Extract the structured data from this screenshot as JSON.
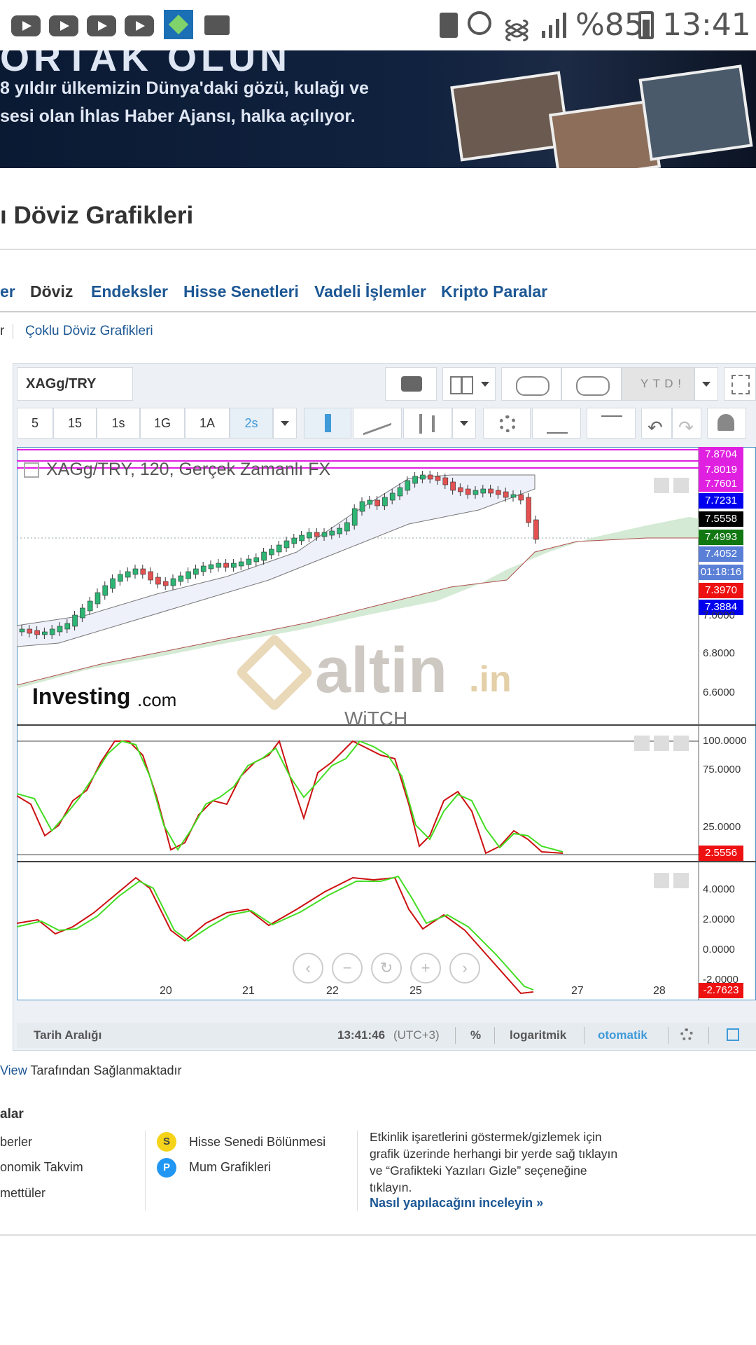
{
  "status_bar": {
    "battery": "%85",
    "time": "13:41"
  },
  "banner": {
    "line1": "8 yıldır ülkemizin Dünya'daki gözü, kulağı ve",
    "line2": "sesi olan İhlas Haber Ajansı, halka açılıyor."
  },
  "page": {
    "title": "ı Döviz Grafikleri"
  },
  "nav": {
    "items": [
      "er",
      "Döviz",
      "Endeksler",
      "Hisse Senetleri",
      "Vadeli İşlemler",
      "Kripto Paralar"
    ]
  },
  "subnav": {
    "prev": "r",
    "link": "Çoklu Döviz Grafikleri"
  },
  "toolbar": {
    "symbol": "XAGg/TRY",
    "ytd_label": "Y T D !",
    "intervals": [
      "5",
      "15",
      "1s",
      "1G",
      "1A",
      "2s"
    ],
    "active_interval": "2s"
  },
  "chart": {
    "series_title": "XAGg/TRY, 120, Gerçek Zamanlı FX",
    "price_labels": [
      {
        "text": "7.8704",
        "color": "#e020e0"
      },
      {
        "text": "7.8019",
        "color": "#e020e0"
      },
      {
        "text": "7.7601",
        "color": "#e020e0"
      },
      {
        "text": "7.7231",
        "color": "#0000ee"
      },
      {
        "text": "7.5558",
        "color": "#000000"
      },
      {
        "text": "7.4993",
        "color": "#117711"
      },
      {
        "text": "7.4052",
        "color": "#5a7fd6"
      },
      {
        "text": "01:18:16",
        "color": "#5a7fd6"
      },
      {
        "text": "7.3970",
        "color": "#ee1111"
      },
      {
        "text": "7.3884",
        "color": "#0000ee"
      }
    ],
    "main_axis": [
      "7.0000",
      "6.8000",
      "6.6000"
    ],
    "stoch_axis": [
      "100.0000",
      "75.0000",
      "25.0000"
    ],
    "stoch_value": "2.5556",
    "macd_axis": [
      "4.0000",
      "2.0000",
      "0.0000",
      "-2.0000"
    ],
    "macd_value": "-2.7623",
    "x_labels": [
      "20",
      "21",
      "22",
      "25",
      "27",
      "28"
    ],
    "watermark_brand": "altin",
    "watermark_tld": ".in",
    "watermark_sub": "WiTCH",
    "investing_logo": "Investing",
    "investing_suffix": ".com"
  },
  "chart_data": {
    "type": "line",
    "title": "XAGg/TRY, 120, Gerçek Zamanlı FX",
    "x": [
      "20",
      "21",
      "22",
      "25",
      "27",
      "28"
    ],
    "ylim": [
      6.6,
      7.87
    ],
    "series": []
  },
  "bottom_bar": {
    "range_label": "Tarih Aralığı",
    "clock": "13:41:46",
    "tz": "(UTC+3)",
    "percent": "%",
    "log": "logaritmik",
    "auto": "otomatik"
  },
  "footer": {
    "provider_link": "View",
    "provider_text": " Tarafından Sağlanmaktadır",
    "section_title": "alar",
    "col1": [
      "berler",
      "onomik Takvim",
      "mettüler"
    ],
    "split_label": "Hisse Senedi Bölünmesi",
    "candle_label": "Mum Grafikleri",
    "info_lines": [
      "Etkinlik işaretlerini göstermek/gizlemek için",
      "grafik üzerinde herhangi bir yerde sağ tıklayın",
      "ve “Grafikteki Yazıları Gizle” seçeneğine",
      "tıklayın."
    ],
    "howto_link": "Nasıl yapılacağını inceleyin »"
  }
}
